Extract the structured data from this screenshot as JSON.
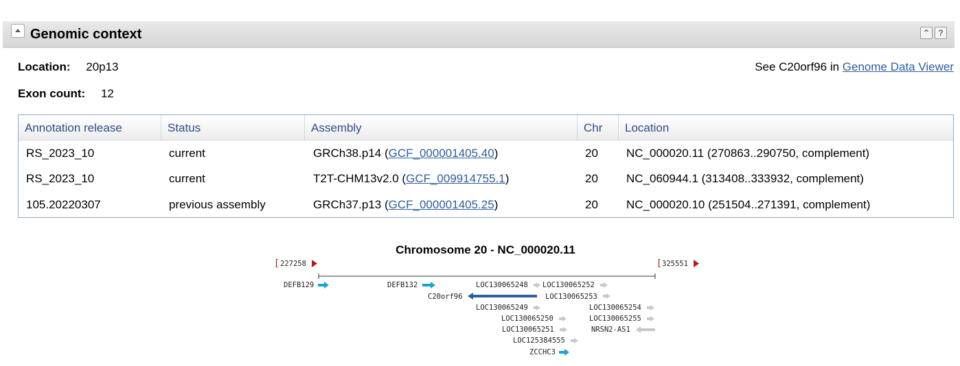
{
  "section": {
    "title": "Genomic context",
    "collapse_icon": "triangle-up",
    "icons": [
      "double-up-icon",
      "help-icon"
    ],
    "help_glyph": "?",
    "double_up_glyph": "⌃"
  },
  "fields": {
    "location_label": "Location:",
    "location_value": "20p13",
    "exon_label": "Exon count:",
    "exon_value": "12"
  },
  "gdv": {
    "prefix": "See C20orf96 in ",
    "link": "Genome Data Viewer"
  },
  "table": {
    "headers": [
      "Annotation release",
      "Status",
      "Assembly",
      "Chr",
      "Location"
    ],
    "rows": [
      {
        "release": "RS_2023_10",
        "status": "current",
        "assembly": "GRCh38.p14",
        "accession": "GCF_000001405.40",
        "chr": "20",
        "location": "NC_000020.11 (270863..290750, complement)"
      },
      {
        "release": "RS_2023_10",
        "status": "current",
        "assembly": "T2T-CHM13v2.0",
        "accession": "GCF_009914755.1",
        "chr": "20",
        "location": "NC_060944.1 (313408..333932, complement)"
      },
      {
        "release": "105.20220307",
        "status": "previous assembly",
        "assembly": "GRCh37.p13",
        "accession": "GCF_000001405.25",
        "chr": "20",
        "location": "NC_000020.10 (251504..271391, complement)"
      }
    ]
  },
  "graphic": {
    "title": "Chromosome 20 - NC_000020.11",
    "start": "227258",
    "end": "325551",
    "colors": {
      "blue_gene": "#1aa3d6",
      "focus_gene": "#2d5f9a",
      "gray_gene": "#c8c8c8",
      "flag": "#b31b1b"
    },
    "genes": [
      {
        "name": "DEFB129",
        "strand": "+",
        "color": "blue"
      },
      {
        "name": "DEFB132",
        "strand": "+",
        "color": "blue"
      },
      {
        "name": "LOC130065248",
        "strand": "+",
        "color": "gray"
      },
      {
        "name": "LOC130065252",
        "strand": "+",
        "color": "gray"
      },
      {
        "name": "C20orf96",
        "strand": "-",
        "color": "focus"
      },
      {
        "name": "LOC130065253",
        "strand": "+",
        "color": "gray"
      },
      {
        "name": "LOC130065249",
        "strand": "+",
        "color": "gray"
      },
      {
        "name": "LOC130065254",
        "strand": "+",
        "color": "gray"
      },
      {
        "name": "LOC130065250",
        "strand": "+",
        "color": "gray"
      },
      {
        "name": "LOC130065255",
        "strand": "+",
        "color": "gray"
      },
      {
        "name": "LOC130065251",
        "strand": "+",
        "color": "gray"
      },
      {
        "name": "NRSN2-AS1",
        "strand": "-",
        "color": "gray"
      },
      {
        "name": "LOC125384555",
        "strand": "+",
        "color": "gray"
      },
      {
        "name": "ZCCHC3",
        "strand": "+",
        "color": "blue"
      }
    ]
  }
}
